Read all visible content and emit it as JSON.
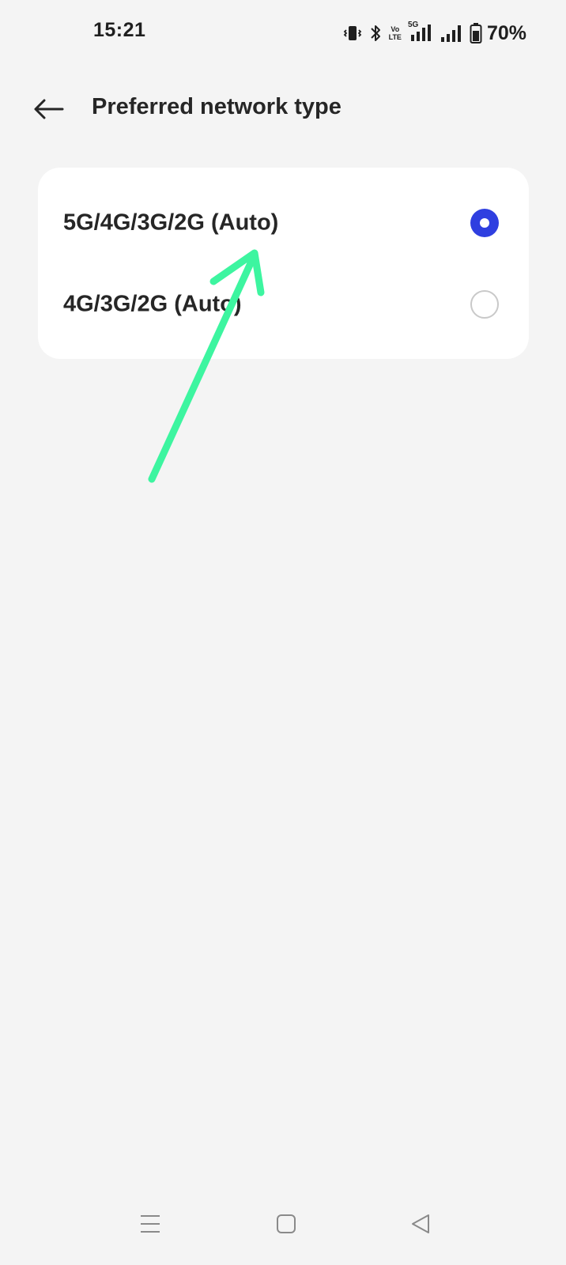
{
  "status_bar": {
    "time": "15:21",
    "battery": "70%",
    "icons": [
      "vibrate-icon",
      "bluetooth-icon",
      "volte-icon",
      "5g-signal-icon",
      "signal-icon",
      "battery-icon"
    ],
    "lte_top": "Vo",
    "lte_bottom": "LTE",
    "network_badge": "5G"
  },
  "header": {
    "title": "Preferred network type",
    "back_icon": "arrow-left-icon"
  },
  "options": [
    {
      "label": "5G/4G/3G/2G (Auto)",
      "selected": true
    },
    {
      "label": "4G/3G/2G (Auto)",
      "selected": false
    }
  ],
  "colors": {
    "accent": "#2f3fe0",
    "annotation": "#3df5a0",
    "background": "#f4f4f4",
    "card": "#ffffff"
  },
  "nav_bar": {
    "icons": [
      "menu-icon",
      "home-icon",
      "back-triangle-icon"
    ]
  }
}
